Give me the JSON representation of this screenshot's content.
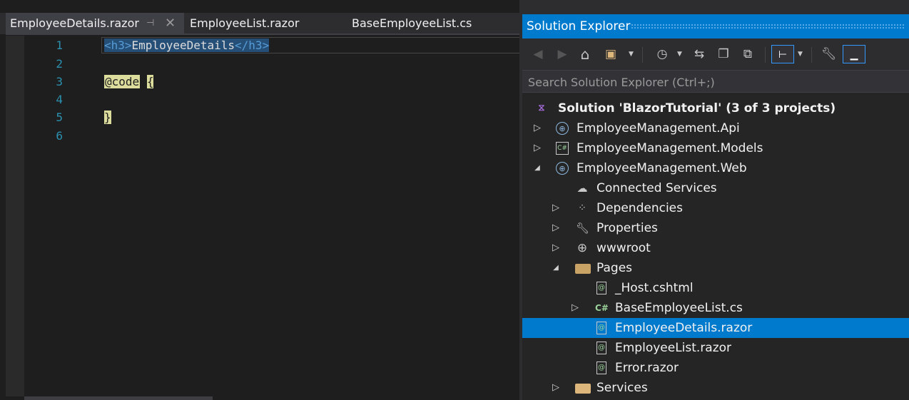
{
  "editor": {
    "tabs": [
      {
        "label": "EmployeeDetails.razor",
        "active": true
      },
      {
        "label": "EmployeeList.razor",
        "active": false
      },
      {
        "label": "BaseEmployeeList.cs",
        "active": false
      }
    ],
    "pin_glyph": "⊣",
    "close_glyph": "✕",
    "line_numbers": [
      "1",
      "2",
      "3",
      "4",
      "5",
      "6"
    ],
    "code": {
      "line1": {
        "open_tag": "<h3>",
        "text": "EmployeeDetails",
        "close_tag": "</h3>"
      },
      "line3": {
        "directive": "@code",
        "brace": "{"
      },
      "line5": {
        "brace": "}"
      }
    }
  },
  "solution_explorer": {
    "title": "Solution Explorer",
    "search_placeholder": "Search Solution Explorer (Ctrl+;)",
    "toolbar": {
      "icons": [
        "back-icon",
        "forward-icon",
        "home-icon",
        "switch-views-icon",
        "pending-changes-filter-icon",
        "sync-icon",
        "collapse-all-icon",
        "show-all-files-icon",
        "preview-selected-icon",
        "properties-icon",
        "pin-toolwindow-icon"
      ]
    },
    "tree": [
      {
        "label": "Solution 'BlazorTutorial' (3 of 3 projects)",
        "bold": true,
        "icon": "solution-icon",
        "expander": "",
        "selected": false
      },
      {
        "label": "EmployeeManagement.Api",
        "icon": "web-project-icon",
        "expander": "▷",
        "selected": false
      },
      {
        "label": "EmployeeManagement.Models",
        "icon": "csharp-project-icon",
        "expander": "▷",
        "selected": false
      },
      {
        "label": "EmployeeManagement.Web",
        "icon": "web-project-icon",
        "expander": "◢",
        "selected": false
      },
      {
        "label": "Connected Services",
        "icon": "connected-services-icon",
        "expander": "",
        "selected": false
      },
      {
        "label": "Dependencies",
        "icon": "dependencies-icon",
        "expander": "▷",
        "selected": false
      },
      {
        "label": "Properties",
        "icon": "wrench-icon",
        "expander": "▷",
        "selected": false
      },
      {
        "label": "wwwroot",
        "icon": "globe-icon",
        "expander": "▷",
        "selected": false
      },
      {
        "label": "Pages",
        "icon": "folder-open-icon",
        "expander": "◢",
        "selected": false
      },
      {
        "label": "_Host.cshtml",
        "icon": "razor-file-icon",
        "expander": "",
        "selected": false
      },
      {
        "label": "BaseEmployeeList.cs",
        "icon": "csharp-file-icon",
        "expander": "▷",
        "selected": false
      },
      {
        "label": "EmployeeDetails.razor",
        "icon": "razor-file-icon",
        "expander": "",
        "selected": true
      },
      {
        "label": "EmployeeList.razor",
        "icon": "razor-file-icon",
        "expander": "",
        "selected": false
      },
      {
        "label": "Error.razor",
        "icon": "razor-file-icon",
        "expander": "",
        "selected": false
      },
      {
        "label": "Services",
        "icon": "folder-icon",
        "expander": "▷",
        "selected": false
      }
    ]
  },
  "colors": {
    "accent": "#007acc",
    "editor_bg": "#1e1e1e",
    "line_number": "#2b91af",
    "html_tag": "#569cd6",
    "razor_highlight": "#dcdc9d"
  }
}
